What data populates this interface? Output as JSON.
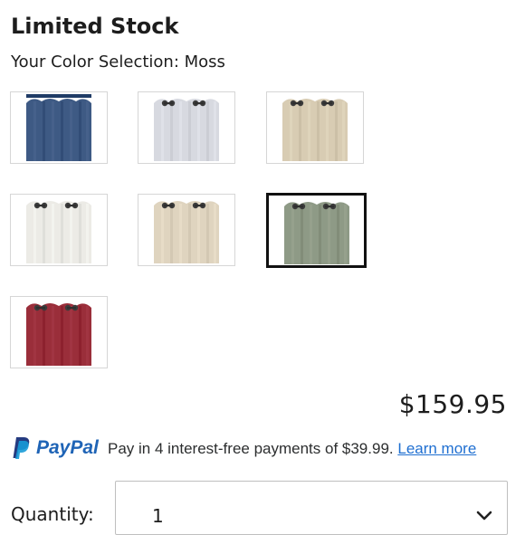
{
  "product": {
    "stock_status": "Limited Stock",
    "color_selection_text": "Your Color Selection: Moss"
  },
  "swatches": [
    {
      "name": "navy-blue",
      "color": "#3e5a84",
      "grommets": false,
      "selected": false
    },
    {
      "name": "light-gray",
      "color": "#d7d9e0",
      "grommets": true,
      "selected": false
    },
    {
      "name": "beige",
      "color": "#d8ccb3",
      "grommets": true,
      "selected": false
    },
    {
      "name": "white",
      "color": "#ecebe6",
      "grommets": true,
      "selected": false
    },
    {
      "name": "linen",
      "color": "#dfd4bf",
      "grommets": true,
      "selected": false
    },
    {
      "name": "moss",
      "color": "#8e9a86",
      "grommets": true,
      "selected": true
    },
    {
      "name": "red",
      "color": "#9a2e3a",
      "grommets": true,
      "selected": false
    }
  ],
  "price": "$159.95",
  "paypal": {
    "brand": "PayPal",
    "message": "Pay in 4 interest-free payments of $39.99.",
    "learn_more": "Learn more",
    "brand_color": "#1f64b6"
  },
  "quantity": {
    "label": "Quantity:",
    "value": "1"
  }
}
